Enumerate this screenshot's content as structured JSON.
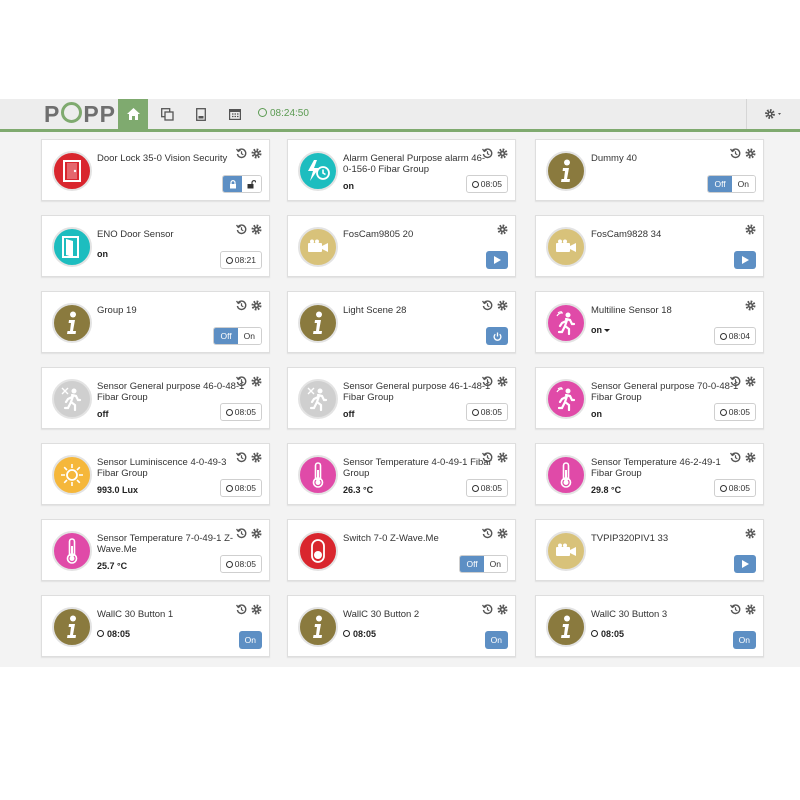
{
  "app": {
    "logo_text": "POPP",
    "clock": "08:24:50",
    "accent": "#7faa6f",
    "button_blue": "#5d8fc4"
  },
  "nav": {
    "items": [
      "home-icon",
      "copy-icon",
      "device-icon",
      "calendar-icon"
    ],
    "settings": "gear-icon"
  },
  "devices": [
    {
      "title": "Door Lock 35-0 Vision Security",
      "icon": "door-icon",
      "color": "#d9262e",
      "control": "lock",
      "history": true
    },
    {
      "title": "Alarm General Purpose alarm 46-0-156-0 Fibar Group",
      "icon": "alarm-icon",
      "color": "#1dbdbf",
      "level": "on",
      "control": "time",
      "time": "08:05",
      "history": true
    },
    {
      "title": "Dummy 40",
      "icon": "info-icon",
      "color": "#8a7a3e",
      "control": "offon",
      "off": "Off",
      "on": "On",
      "history": true
    },
    {
      "title": "ENO Door Sensor",
      "icon": "door-open-icon",
      "color": "#1dbdbf",
      "level": "on",
      "control": "time",
      "time": "08:21",
      "history": true
    },
    {
      "title": "FosCam9805 20",
      "icon": "camera-icon",
      "color": "#d8c27a",
      "control": "play",
      "history": false
    },
    {
      "title": "FosCam9828 34",
      "icon": "camera-icon",
      "color": "#d8c27a",
      "control": "play",
      "history": false
    },
    {
      "title": "Group 19",
      "icon": "info-icon",
      "color": "#8a7a3e",
      "control": "offon",
      "off": "Off",
      "on": "On",
      "history": true
    },
    {
      "title": "Light Scene 28",
      "icon": "info-icon",
      "color": "#8a7a3e",
      "control": "power",
      "history": true
    },
    {
      "title": "Multiline Sensor 18",
      "icon": "motion-icon",
      "color": "#e04aa8",
      "level": "on",
      "dropdown": true,
      "control": "time",
      "time": "08:04",
      "history": false
    },
    {
      "title": "Sensor General purpose 46-0-48-1 Fibar Group",
      "icon": "motion-off-icon",
      "color": "#cfcfcf",
      "level": "off",
      "control": "time",
      "time": "08:05",
      "history": true
    },
    {
      "title": "Sensor General purpose 46-1-48-1 Fibar Group",
      "icon": "motion-off-icon",
      "color": "#cfcfcf",
      "level": "off",
      "control": "time",
      "time": "08:05",
      "history": true
    },
    {
      "title": "Sensor General purpose 70-0-48-1 Fibar Group",
      "icon": "motion-icon",
      "color": "#e04aa8",
      "level": "on",
      "control": "time",
      "time": "08:05",
      "history": true
    },
    {
      "title": "Sensor Luminiscence 4-0-49-3 Fibar Group",
      "icon": "sun-icon",
      "color": "#f5b73b",
      "level": "993.0 Lux",
      "control": "time",
      "time": "08:05",
      "history": true
    },
    {
      "title": "Sensor Temperature 4-0-49-1 Fibar Group",
      "icon": "thermometer-icon",
      "color": "#e04aa8",
      "level": "26.3 °C",
      "control": "time",
      "time": "08:05",
      "history": true
    },
    {
      "title": "Sensor Temperature 46-2-49-1 Fibar Group",
      "icon": "thermometer-icon",
      "color": "#e04aa8",
      "level": "29.8 °C",
      "control": "time",
      "time": "08:05",
      "history": true
    },
    {
      "title": "Sensor Temperature 7-0-49-1 Z-Wave.Me",
      "icon": "thermometer-icon",
      "color": "#e04aa8",
      "level": "25.7 °C",
      "control": "time",
      "time": "08:05",
      "history": true
    },
    {
      "title": "Switch 7-0 Z-Wave.Me",
      "icon": "switch-icon",
      "color": "#d9262e",
      "control": "offon",
      "off": "Off",
      "on": "On",
      "history": true
    },
    {
      "title": "TVPIP320PIV1 33",
      "icon": "camera-icon",
      "color": "#d8c27a",
      "control": "play",
      "history": false
    },
    {
      "title": "WallC 30 Button 1",
      "icon": "info-icon",
      "color": "#8a7a3e",
      "level": "08:05",
      "clock_level": true,
      "control": "on",
      "on": "On",
      "history": true
    },
    {
      "title": "WallC 30 Button 2",
      "icon": "info-icon",
      "color": "#8a7a3e",
      "level": "08:05",
      "clock_level": true,
      "control": "on",
      "on": "On",
      "history": true
    },
    {
      "title": "WallC 30 Button 3",
      "icon": "info-icon",
      "color": "#8a7a3e",
      "level": "08:05",
      "clock_level": true,
      "control": "on",
      "on": "On",
      "history": true
    }
  ]
}
